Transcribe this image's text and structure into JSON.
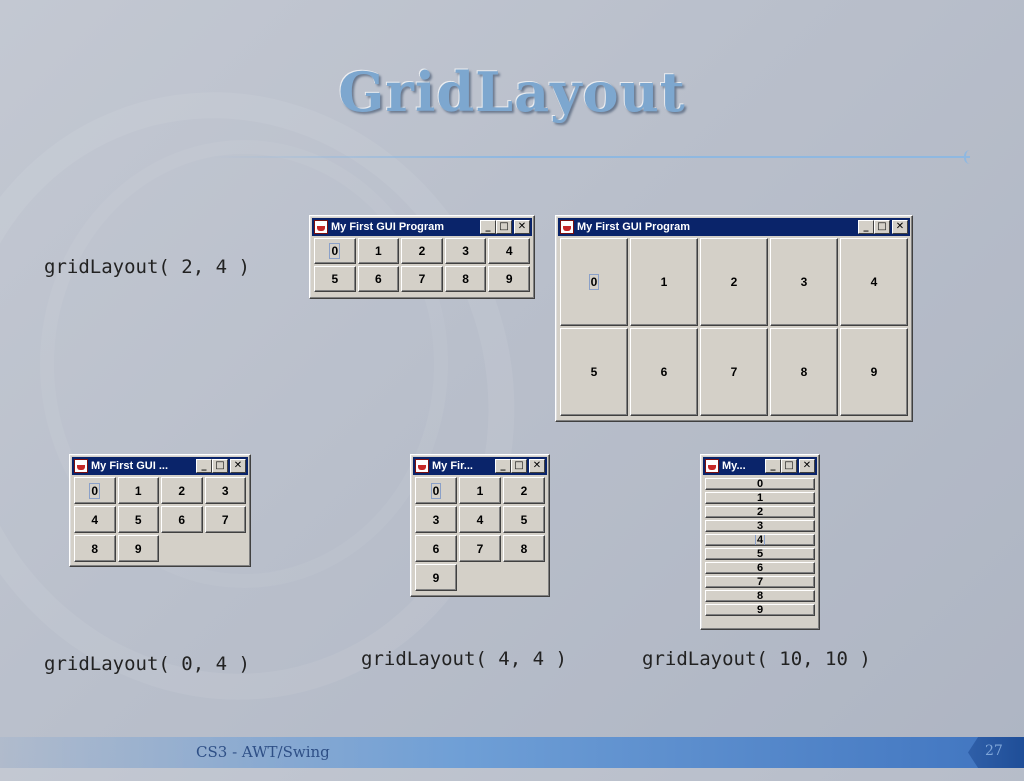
{
  "slide": {
    "title": "GridLayout",
    "footer": "CS3 - AWT/Swing",
    "page_number": "27"
  },
  "captions": {
    "c1": "gridLayout( 2, 4 )",
    "c2": "gridLayout( 0, 4 )",
    "c3": "gridLayout( 4, 4 )",
    "c4": "gridLayout( 10, 10 )"
  },
  "window_controls": {
    "minimize": "_",
    "maximize": "□",
    "close": "✕"
  },
  "windows": [
    {
      "title": "My First GUI Program",
      "buttons": [
        "0",
        "1",
        "2",
        "3",
        "4",
        "5",
        "6",
        "7",
        "8",
        "9"
      ]
    },
    {
      "title": "My First GUI Program",
      "buttons": [
        "0",
        "1",
        "2",
        "3",
        "4",
        "5",
        "6",
        "7",
        "8",
        "9"
      ]
    },
    {
      "title": "My First GUI ...",
      "buttons": [
        "0",
        "1",
        "2",
        "3",
        "4",
        "5",
        "6",
        "7",
        "8",
        "9"
      ]
    },
    {
      "title": "My Fir...",
      "buttons": [
        "0",
        "1",
        "2",
        "3",
        "4",
        "5",
        "6",
        "7",
        "8",
        "9"
      ]
    },
    {
      "title": "My...",
      "buttons": [
        "0",
        "1",
        "2",
        "3",
        "4",
        "5",
        "6",
        "7",
        "8",
        "9"
      ]
    }
  ],
  "colors": {
    "title_text": "#7da7cf",
    "titlebar": "#0a246a",
    "window_face": "#d4d0c8",
    "footer_accent": "#3f74c0"
  }
}
